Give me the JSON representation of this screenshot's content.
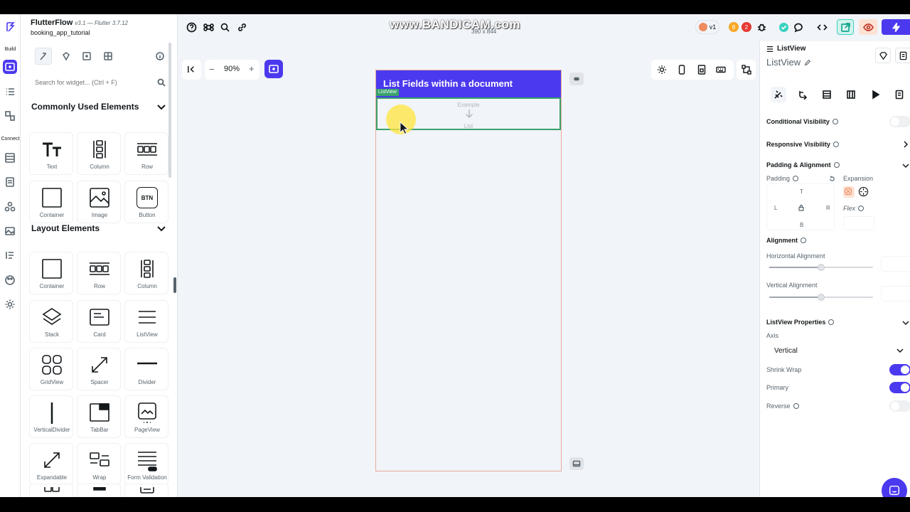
{
  "project": {
    "name": "FlutterFlow",
    "version": "v3.1 — Flutter 3.7.12",
    "subtitle": "booking_app_tutorial"
  },
  "rail": {
    "build_label": "Build",
    "connect_label": "Connect"
  },
  "search": {
    "placeholder": "Search for widget... (Ctrl + F)"
  },
  "common": {
    "title": "Commonly Used Elements",
    "items": [
      {
        "label": "Text",
        "icon": "text-icon"
      },
      {
        "label": "Column",
        "icon": "column-icon"
      },
      {
        "label": "Row",
        "icon": "row-icon"
      },
      {
        "label": "Container",
        "icon": "container-icon"
      },
      {
        "label": "Image",
        "icon": "image-icon"
      },
      {
        "label": "Button",
        "icon": "button-icon",
        "badge": "BTN"
      }
    ]
  },
  "layout": {
    "title": "Layout Elements",
    "items": [
      {
        "label": "Container"
      },
      {
        "label": "Row"
      },
      {
        "label": "Column"
      },
      {
        "label": "Stack"
      },
      {
        "label": "Card"
      },
      {
        "label": "ListView"
      },
      {
        "label": "GridView"
      },
      {
        "label": "Spacer"
      },
      {
        "label": "Divider"
      },
      {
        "label": "VerticalDivider"
      },
      {
        "label": "TabBar"
      },
      {
        "label": "PageView"
      },
      {
        "label": "Expandable"
      },
      {
        "label": "Wrap"
      },
      {
        "label": "Form Validation"
      }
    ]
  },
  "canvas": {
    "zoom": "90%",
    "watermark": "www.BANDICAM.com",
    "device_size": "390 x 844",
    "app_bar_title": "List Fields within a document",
    "listview_tag": "ListView",
    "listview_example": "Example",
    "listview_list": "List"
  },
  "topbar": {
    "version_label": "v1",
    "count_orange": "8",
    "count_red": "2"
  },
  "properties": {
    "widget_type": "ListView",
    "widget_name": "ListView",
    "conditional_visibility": "Conditional Visibility",
    "responsive_visibility": "Responsive Visibility",
    "padding_alignment": "Padding & Alignment",
    "padding": "Padding",
    "expansion": "Expansion",
    "pad_t": "T",
    "pad_l": "L",
    "pad_r": "R",
    "pad_b": "B",
    "flex": "Flex",
    "alignment": "Alignment",
    "horizontal_alignment": "Horizontal Alignment",
    "vertical_alignment": "Vertical Alignment",
    "h_align_value": 0.5,
    "v_align_value": 0.5,
    "listview_properties": "ListView Properties",
    "axis": "Axis",
    "axis_value": "Vertical",
    "shrink_wrap": "Shrink Wrap",
    "primary": "Primary",
    "reverse": "Reverse",
    "shrink_wrap_on": true,
    "primary_on": true,
    "reverse_on": false,
    "conditional_visibility_on": false
  },
  "colors": {
    "primary": "#4b39ef",
    "listview_outline": "#39a26d",
    "phone_border": "#e7ab9a",
    "cursor_highlight": "#ffe63c"
  }
}
